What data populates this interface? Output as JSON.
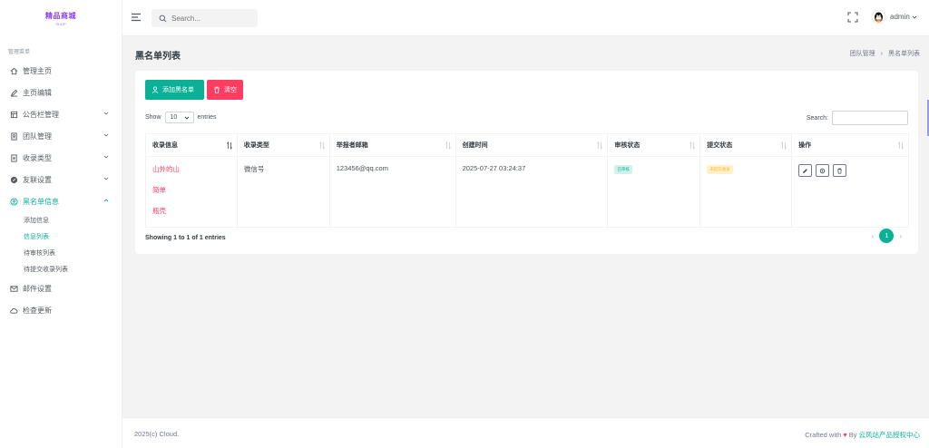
{
  "logo": {
    "line1": "精品商城",
    "line2": "SHOP"
  },
  "sidebar": {
    "section_title": "管理菜单",
    "items": [
      {
        "label": "管理主页",
        "icon": "home-icon"
      },
      {
        "label": "主页编辑",
        "icon": "edit-icon"
      },
      {
        "label": "公告栏管理",
        "icon": "board-icon"
      },
      {
        "label": "团队管理",
        "icon": "team-icon"
      },
      {
        "label": "收录类型",
        "icon": "file-icon"
      },
      {
        "label": "友联设置",
        "icon": "link-icon"
      },
      {
        "label": "黑名单信息",
        "icon": "user-block-icon"
      },
      {
        "label": "邮件设置",
        "icon": "mail-icon"
      },
      {
        "label": "检查更新",
        "icon": "cloud-icon"
      }
    ],
    "sub_items": [
      {
        "label": "添加信息"
      },
      {
        "label": "信息列表"
      },
      {
        "label": "待审核列表"
      },
      {
        "label": "待提交收录列表"
      }
    ]
  },
  "topbar": {
    "search_placeholder": "Search...",
    "user_name": "admin"
  },
  "page": {
    "title": "黑名单列表",
    "breadcrumb": [
      "团队管理",
      "黑名单列表"
    ]
  },
  "toolbar": {
    "add_label": "添加黑名单",
    "clear_label": "清空"
  },
  "table_controls": {
    "show_label": "Show",
    "page_size": "10",
    "entries_label": "entries",
    "search_label": "Search:"
  },
  "table": {
    "headers": [
      "收录信息",
      "收录类型",
      "举报者邮箱",
      "创建时间",
      "审核状态",
      "提交状态",
      "操作"
    ],
    "rows": [
      {
        "info": [
          "山外的山",
          "简单",
          "瓶壳"
        ],
        "type": "微信号",
        "email": "123456@qq.com",
        "created": "2025-07-27 03:24:37",
        "review_status": "已审核",
        "submit_status": "未提交收录"
      }
    ]
  },
  "pagination": {
    "showing": "Showing 1 to 1 of 1 entries",
    "prev": "‹",
    "next": "›",
    "current": "1"
  },
  "footer": {
    "copyright": "2025(c) Cloud.",
    "crafted": "Crafted with",
    "by": "By",
    "link": "云风站产品授权中心"
  },
  "colors": {
    "accent": "#0bb197",
    "danger": "#ff3d60",
    "warning": "#fcb92c"
  }
}
